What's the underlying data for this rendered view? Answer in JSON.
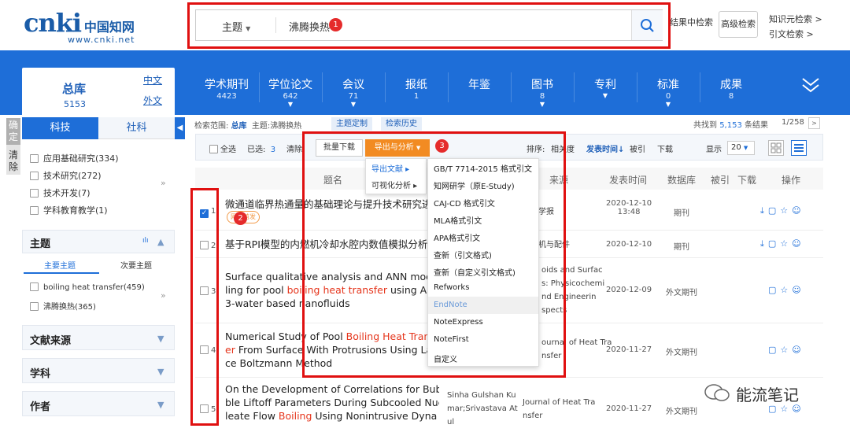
{
  "logo": {
    "brand": "cnki",
    "cn_name": "中国知网",
    "url_text": "www.cnki.net"
  },
  "search": {
    "type_label": "主题",
    "value": "沸腾换热",
    "result_search": "结果中检索",
    "advanced": "高级检索",
    "knowledge_search": "知识元检索 >",
    "citation_search": "引文检索 >"
  },
  "annotations": {
    "n1": "1",
    "n2": "2",
    "n3": "3"
  },
  "total": {
    "title": "总库",
    "count": "5153",
    "lang_zh": "中文",
    "lang_en": "外文"
  },
  "db_tabs": [
    {
      "label": "学术期刊",
      "count": "4423"
    },
    {
      "label": "学位论文",
      "count": "642"
    },
    {
      "label": "会议",
      "count": "71"
    },
    {
      "label": "报纸",
      "count": "1"
    },
    {
      "label": "年鉴",
      "count": ""
    },
    {
      "label": "图书",
      "count": "8"
    },
    {
      "label": "专利",
      "count": ""
    },
    {
      "label": "标准",
      "count": "0"
    },
    {
      "label": "成果",
      "count": "8"
    }
  ],
  "sidebar": {
    "strip": [
      "确定",
      "清除"
    ],
    "tab_sci": "科技",
    "tab_soc": "社科",
    "categories": [
      "应用基础研究(334)",
      "技术研究(272)",
      "技术开发(7)",
      "学科教育教学(1)"
    ],
    "topic_title": "主题",
    "main_topic": "主要主题",
    "sub_topic": "次要主题",
    "topics": [
      "boiling heat transfer(459)",
      "沸腾换热(365)"
    ],
    "source_title": "文献来源",
    "subject_title": "学科",
    "author_title": "作者"
  },
  "results": {
    "scope_label": "检索范围:",
    "scope_value": "总库",
    "topic_label": "主题:",
    "topic_value": "沸腾换热",
    "topic_custom": "主题定制",
    "search_history": "检索历史",
    "found_prefix": "共找到",
    "found_count": "5,153",
    "found_suffix": "条结果",
    "page": "1/258",
    "select_all": "全选",
    "selected_label": "已选:",
    "selected_count": "3",
    "clear": "清除",
    "batch_download": "批量下载",
    "export": "导出与分析",
    "sort_label": "排序:",
    "sort_relevance": "相关度",
    "sort_date": "发表时间",
    "sort_cited": "被引",
    "sort_download": "下载",
    "display_label": "显示",
    "display_value": "20",
    "columns": [
      "题名",
      "来源",
      "发表时间",
      "数据库",
      "被引",
      "下载",
      "操作"
    ],
    "rows": [
      {
        "num": "1",
        "checked": true,
        "title_parts": [
          "微通道临界热通量的基础理论与提升技术研究进"
        ],
        "badge": "网络首发",
        "source": "学报",
        "date": "2020-12-10\n13:48",
        "db": "期刊"
      },
      {
        "num": "2",
        "checked": false,
        "title_parts": [
          "基于RPI模型的内燃机冷却水腔内数值模拟分析"
        ],
        "source": "机与配件",
        "date": "2020-12-10",
        "db": "期刊"
      },
      {
        "num": "3",
        "checked": false,
        "title_a": "Surface qualitative analysis and ANN mode",
        "title_b1": "ling for pool ",
        "title_b_hl": "boiling heat transfer",
        "title_b2": " using Al2",
        "title_c": "3-water based nanofluids",
        "source": "oids and Surfac\ns: Physicochemi\nnd Engineerin\nspects",
        "date": "2020-12-09",
        "db": "外文期刊"
      },
      {
        "num": "4",
        "checked": false,
        "title_a1": "Numerical Study of Pool ",
        "title_a_hl": "Boiling Heat Tran",
        "title_b_hl": "er",
        "title_b2": " From Surface With Protrusions Using La",
        "title_c": "ce Boltzmann Method",
        "source": "ournal of Heat Tra\nnsfer",
        "date": "2020-11-27",
        "db": "外文期刊"
      },
      {
        "num": "5",
        "checked": false,
        "title_a": "On the Development of Correlations for Bub",
        "title_b": "ble Liftoff Parameters During Subcooled Nuc",
        "title_c1": "leate Flow ",
        "title_c_hl": "Boiling",
        "title_c2": " Using Nonintrusive Dyna",
        "author": "Sinha Gulshan Ku\nmar;Srivastava At\nul",
        "source": "Journal of Heat Tra\nnsfer",
        "date": "2020-11-27",
        "db": "外文期刊"
      }
    ]
  },
  "export_menu": {
    "sub_items": [
      "导出文献 ▸",
      "可视化分析 ▸"
    ],
    "formats": [
      "GB/T 7714-2015 格式引文",
      "知网研学（原E-Study)",
      "CAJ-CD 格式引文",
      "MLA格式引文",
      "APA格式引文",
      "查新（引文格式)",
      "查新（自定义引文格式)",
      "Refworks",
      "EndNote",
      "NoteExpress",
      "NoteFirst",
      "自定义"
    ]
  },
  "watermark": "能流笔记",
  "colors": {
    "primary_blue": "#1e6ed8",
    "export_orange": "#f28b22",
    "highlight_red": "#e5341b",
    "annotation_red": "#e01010"
  }
}
